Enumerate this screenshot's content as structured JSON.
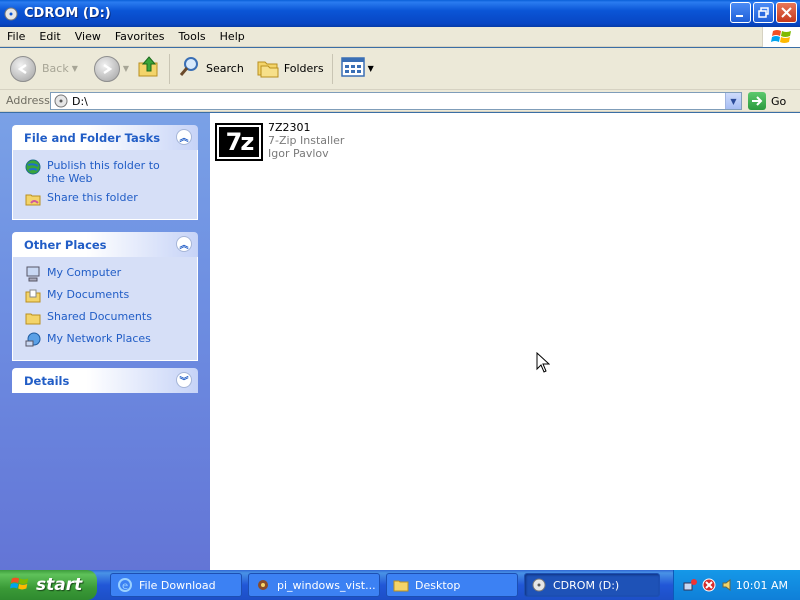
{
  "window": {
    "title": "CDROM (D:)"
  },
  "menu": [
    "File",
    "Edit",
    "View",
    "Favorites",
    "Tools",
    "Help"
  ],
  "toolbar": {
    "back_label": "Back",
    "search_label": "Search",
    "folders_label": "Folders"
  },
  "address": {
    "label": "Address",
    "value": "D:\\",
    "go_label": "Go"
  },
  "taskpane": {
    "file_tasks": {
      "title": "File and Folder Tasks",
      "items": [
        "Publish this folder to the Web",
        "Share this folder"
      ]
    },
    "other_places": {
      "title": "Other Places",
      "items": [
        "My Computer",
        "My Documents",
        "Shared Documents",
        "My Network Places"
      ]
    },
    "details": {
      "title": "Details"
    }
  },
  "files": [
    {
      "name": "7Z2301",
      "type": "7-Zip Installer",
      "company": "Igor Pavlov",
      "icon_text": "7z"
    }
  ],
  "taskbar": {
    "start_label": "start",
    "tasks": [
      "File Download",
      "pi_windows_vist...",
      "Desktop",
      "CDROM (D:)"
    ],
    "clock": "10:01 AM"
  },
  "colors": {
    "title_blue": "#0a55d6",
    "link_blue": "#215dc6",
    "taskbar_blue": "#2157d7",
    "start_green": "#3a9a37"
  }
}
